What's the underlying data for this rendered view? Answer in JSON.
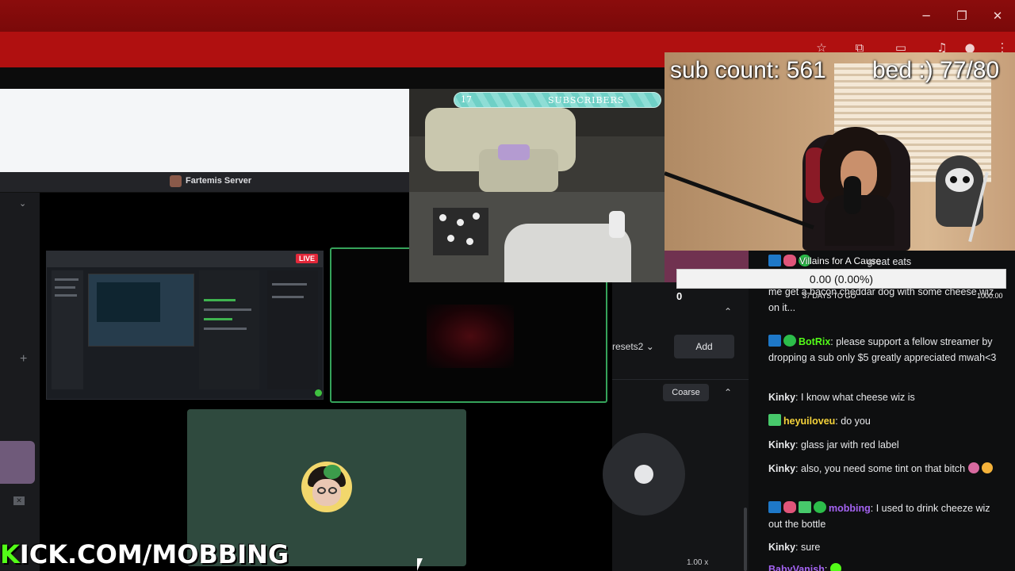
{
  "window": {
    "controls": {
      "minimize": "─",
      "restore": "❐",
      "close": "✕"
    },
    "colors": {
      "titlebar": "#8b0c0c",
      "toolbar": "#b01010"
    }
  },
  "toolbar_icons": [
    "star-icon",
    "extensions-icon",
    "cast-icon",
    "media-icon",
    "profile-icon",
    "menu-icon"
  ],
  "discord": {
    "server_name": "Fartemis Server",
    "live_badge": "LIVE",
    "accent": "#35a35a"
  },
  "obs": {
    "presets_label": "resets2",
    "add_label": "Add",
    "coarse_label": "Coarse",
    "speed_label": "1.00 x"
  },
  "overlay": {
    "sub_count": "sub count: 561",
    "bed_goal": "bed :) 77/80",
    "sub_bar_number": "17",
    "sub_bar_label": "SUBSCRIBERS",
    "goal_title": "Villains for A Cause",
    "goal_value": "0.00 (0.00%)",
    "goal_days": "37 DAYS TO GO",
    "goal_start": "0",
    "goal_target": "1000.00",
    "kick_prefix": "K",
    "kick_rest": "ICK.COM/MOBBING",
    "brand_green": "#53fc18"
  },
  "chat": {
    "messages": [
      {
        "user": "",
        "text": "great eats",
        "user_color": "#e7e8ea"
      },
      {
        "user": "",
        "text": "me get a bacon cheddar dog with some cheese wiz on it...",
        "user_color": "#e7e8ea"
      },
      {
        "user": "BotRix",
        "text": "please support a fellow streamer by dropping a sub only $5 greatly appreciated mwah<3",
        "user_color": "#53fc18"
      },
      {
        "user": "Kinky",
        "text": "I know what cheese wiz is",
        "user_color": "#e7e8ea"
      },
      {
        "user": "heyuiloveu",
        "text": "do you",
        "user_color": "#f5d33a"
      },
      {
        "user": "Kinky",
        "text": "glass jar with red label",
        "user_color": "#e7e8ea"
      },
      {
        "user": "Kinky",
        "text": "also, you need some tint on that bitch",
        "user_color": "#e7e8ea"
      },
      {
        "user": "mobbing",
        "text": "I used to drink cheeze wiz out the bottle",
        "user_color": "#a463f2"
      },
      {
        "user": "Kinky",
        "text": "sure",
        "user_color": "#e7e8ea"
      },
      {
        "user": "BabyVanish",
        "text": "",
        "user_color": "#a463f2"
      }
    ]
  }
}
